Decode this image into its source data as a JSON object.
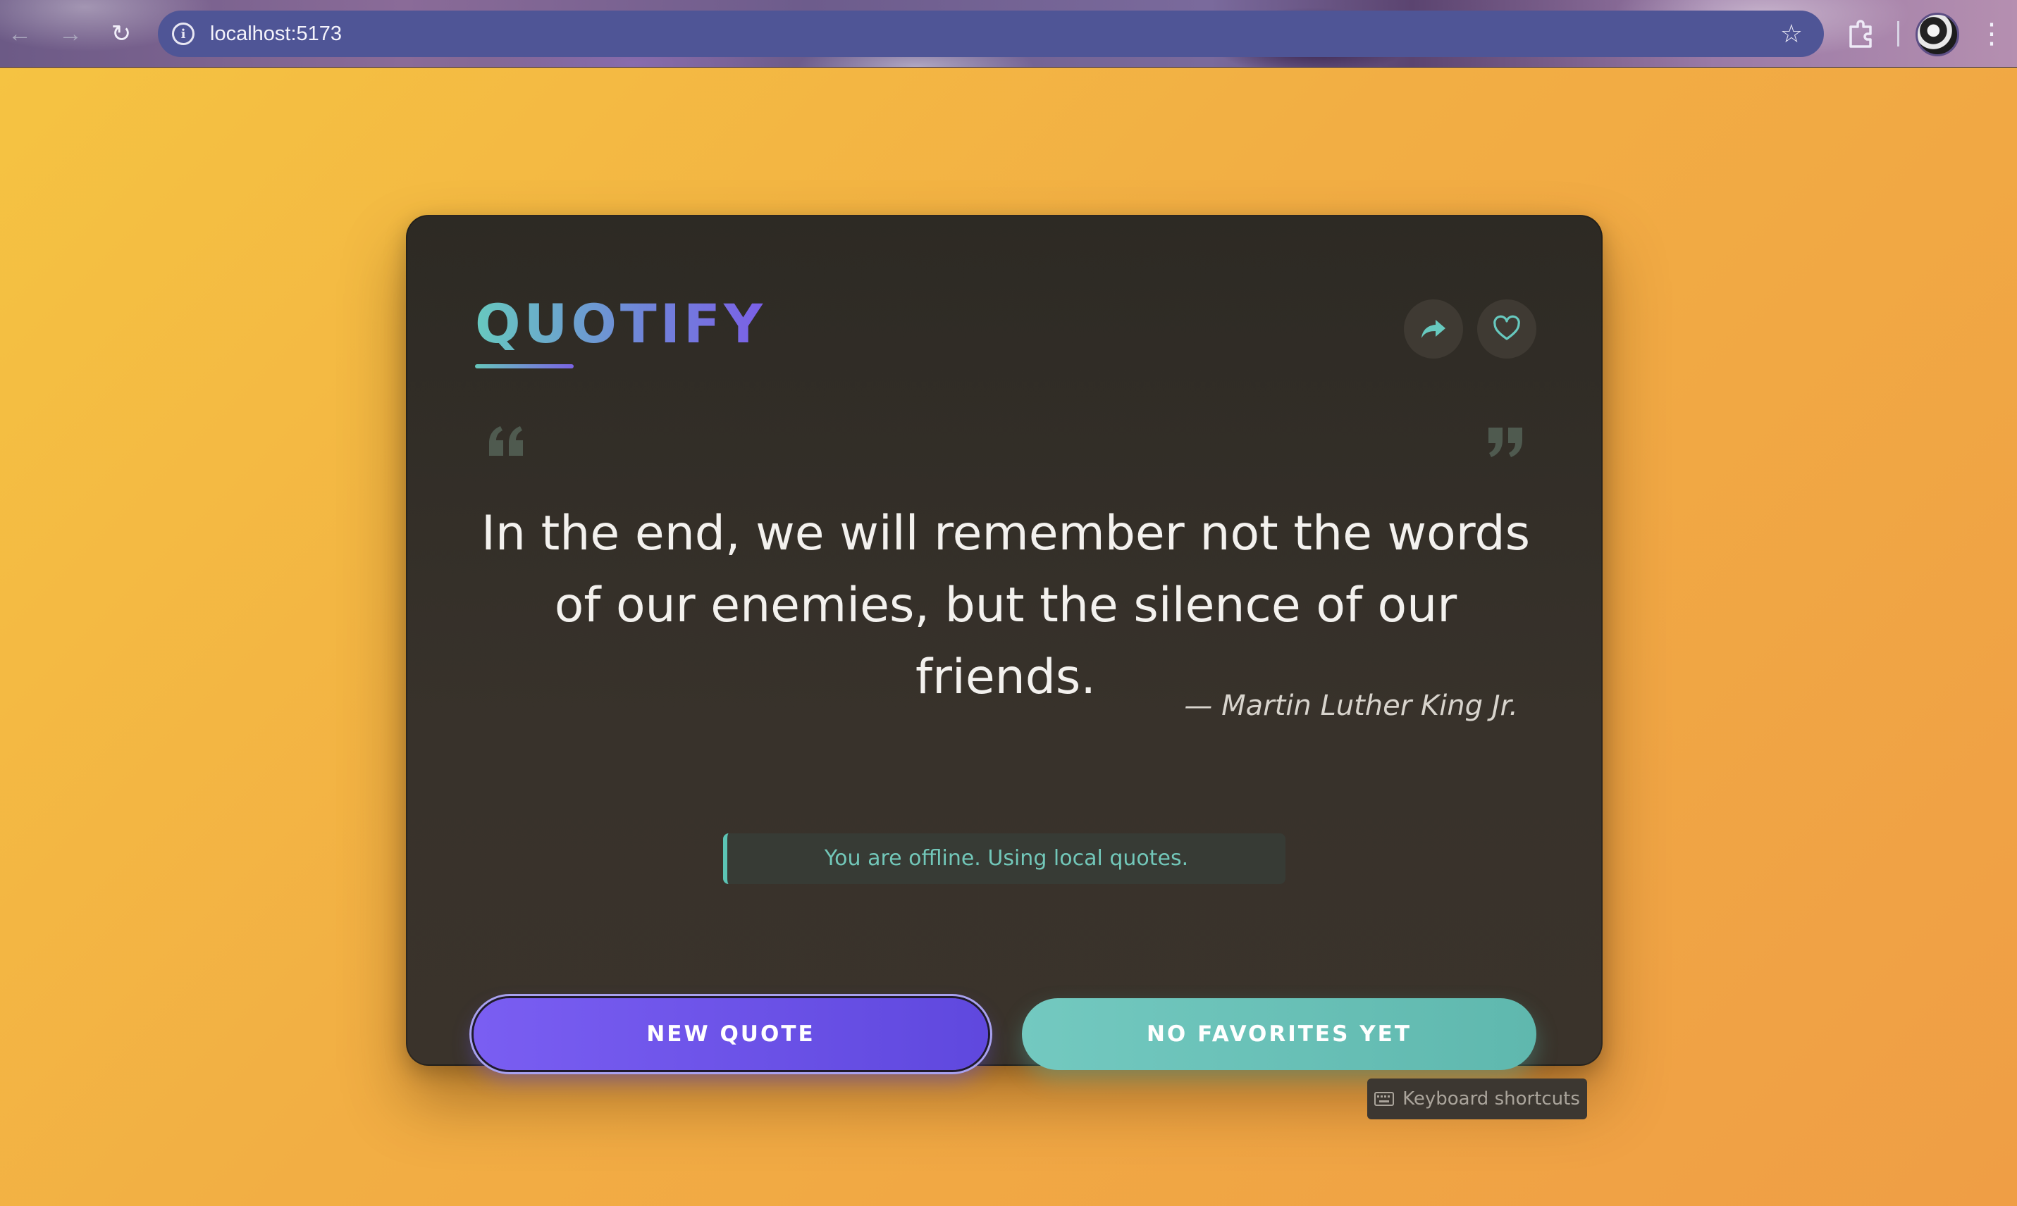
{
  "browser": {
    "url": "localhost:5173",
    "back_icon": "arrow-left-icon",
    "forward_icon": "arrow-right-icon",
    "reload_icon": "reload-icon",
    "info_icon": "info-icon",
    "bookmark_icon": "star-icon",
    "extensions_icon": "puzzle-icon",
    "menu_icon": "kebab-menu-icon"
  },
  "app": {
    "brand": "QUOTIFY",
    "share_icon": "share-arrow-icon",
    "favorite_icon": "heart-icon",
    "quote": "In the end, we will remember not the words of our enemies, but the silence of our friends.",
    "author": "— Martin Luther King Jr.",
    "status_message": "You are offline. Using local quotes.",
    "new_quote_label": "NEW QUOTE",
    "favorites_label": "NO FAVORITES YET",
    "keyboard_hint": "Keyboard shortcuts",
    "keyboard_icon": "keyboard-icon"
  },
  "colors": {
    "background_start": "#f5c342",
    "background_end": "#ef9e45",
    "card": "#332e28",
    "accent_teal": "#67c9bf",
    "accent_purple": "#6f55ea"
  }
}
